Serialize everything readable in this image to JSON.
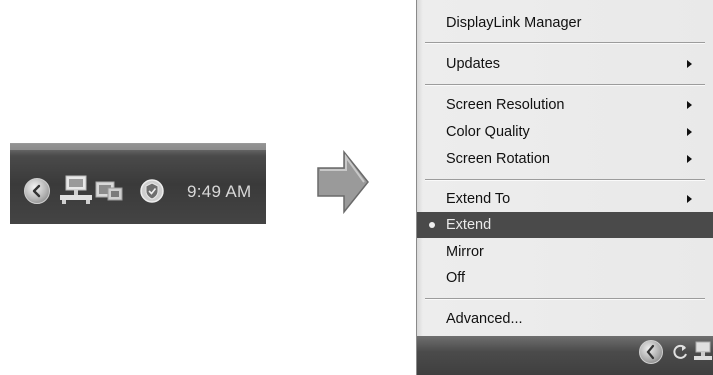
{
  "tray": {
    "clock": "9:49 AM",
    "icons": [
      "expand-chevron-icon",
      "displaylink-network-icon",
      "monitor-icon",
      "security-shield-icon"
    ]
  },
  "arrow_icon": "right-arrow-icon",
  "menu": {
    "title": "DisplayLink Manager",
    "items": [
      {
        "label": "Updates",
        "submenu": true
      },
      {
        "label": "Screen Resolution",
        "submenu": true
      },
      {
        "label": "Color Quality",
        "submenu": true
      },
      {
        "label": "Screen Rotation",
        "submenu": true
      },
      {
        "label": "Extend To",
        "submenu": true
      },
      {
        "label": "Extend",
        "selected": true
      },
      {
        "label": "Mirror"
      },
      {
        "label": "Off"
      },
      {
        "label": "Advanced..."
      }
    ]
  },
  "colors": {
    "selected_bg": "#4a4a4a",
    "menu_bg": "#e6e6e6",
    "taskbar": "#3a3a3a"
  }
}
